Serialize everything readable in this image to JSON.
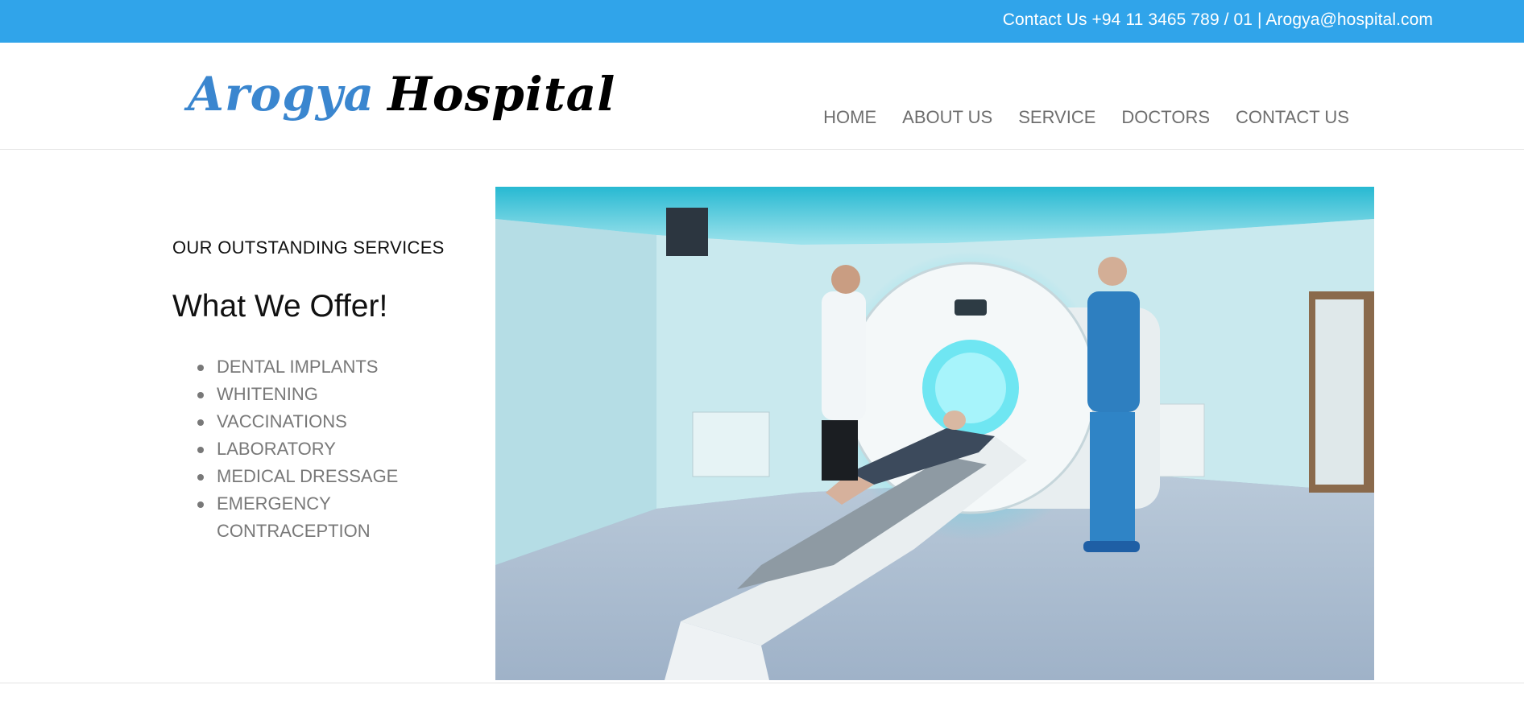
{
  "topbar": {
    "contact_text": "Contact Us +94 11 3465 789 / 01 | Arogya@hospital.com"
  },
  "logo": {
    "word1": "Arogya",
    "word2": "Hospital"
  },
  "nav": {
    "items": [
      "HOME",
      "ABOUT US",
      "SERVICE",
      "DOCTORS",
      "CONTACT US"
    ]
  },
  "services": {
    "eyebrow": "OUR OUTSTANDING SERVICES",
    "headline": "What We Offer!",
    "items": [
      "DENTAL IMPLANTS",
      "WHITENING",
      "VACCINATIONS",
      "LABORATORY",
      "MEDICAL DRESSAGE",
      "EMERGENCY CONTRACEPTION"
    ]
  },
  "colors": {
    "topbar_bg": "#30a4ea",
    "logo_blue": "#3a86cf",
    "nav_text": "#6e6e6e",
    "list_text": "#787878"
  }
}
